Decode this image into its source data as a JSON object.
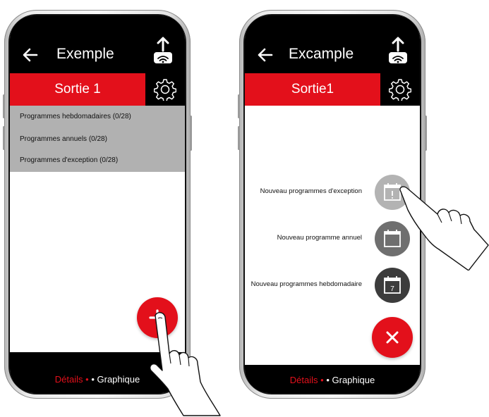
{
  "left_screen": {
    "title": "Exemple",
    "output_label": "Sortie 1",
    "list_items": [
      "Programmes hebdomadaires (0/28)",
      "Programmes annuels (0/28)",
      "Programmes d'exception (0/28)"
    ],
    "fab_icon": "plus-icon",
    "bottom_tabs": {
      "details": "Détails",
      "separator": "•",
      "graphique": "• Graphique"
    }
  },
  "right_screen": {
    "title": "Excample",
    "output_label": "Sortie1",
    "menu": [
      {
        "label": "Nouveau programmes d'exception",
        "icon": "calendar-exclamation-icon",
        "color": "#b3b3b3"
      },
      {
        "label": "Nouveau programme annuel",
        "icon": "calendar-icon",
        "color": "#6f6f6f"
      },
      {
        "label": "Nouveau programmes hebdomadaire",
        "icon": "calendar-7-icon",
        "calendar_number": "7",
        "color": "#3c3c3c"
      }
    ],
    "close_icon": "close-icon",
    "bottom_tabs": {
      "details": "Détails",
      "separator": "•",
      "graphique": "• Graphique"
    }
  },
  "colors": {
    "accent": "#e3101b",
    "appbar": "#000000",
    "list_bg": "#b1b1b1"
  }
}
